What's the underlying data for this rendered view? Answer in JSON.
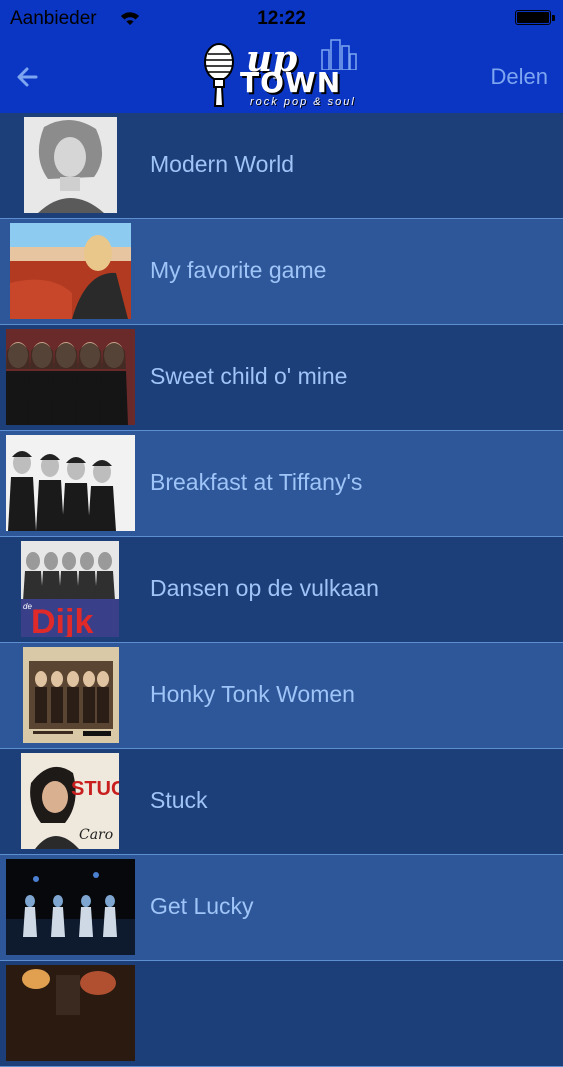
{
  "status_bar": {
    "carrier": "Aanbieder",
    "time": "12:22",
    "battery_level": 1.0
  },
  "nav": {
    "back_icon": "arrow-left-icon",
    "share_label": "Delen",
    "logo": {
      "up": "up",
      "town": "TOWN",
      "tagline": "rock pop & soul"
    }
  },
  "songs": [
    {
      "title": "Modern World",
      "thumb": "portrait-bw"
    },
    {
      "title": "My favorite game",
      "thumb": "car-red"
    },
    {
      "title": "Sweet child o' mine",
      "thumb": "band-dark"
    },
    {
      "title": "Breakfast at Tiffany's",
      "thumb": "band-bw"
    },
    {
      "title": "Dansen op de vulkaan",
      "thumb": "dijk-cover",
      "cover_text": "Dijk",
      "cover_small": "de"
    },
    {
      "title": "Honky Tonk Women",
      "thumb": "stones-cover"
    },
    {
      "title": "Stuck",
      "thumb": "caro-cover",
      "cover_text": "STUCK",
      "cover_sig": "Caro"
    },
    {
      "title": "Get Lucky",
      "thumb": "stage-blue"
    },
    {
      "title": "",
      "thumb": "stage-partial"
    }
  ],
  "colors": {
    "navbar": "#0b36c4",
    "row_odd": "#1d3f79",
    "row_even": "#2d5799",
    "label": "#9fc4f7"
  }
}
